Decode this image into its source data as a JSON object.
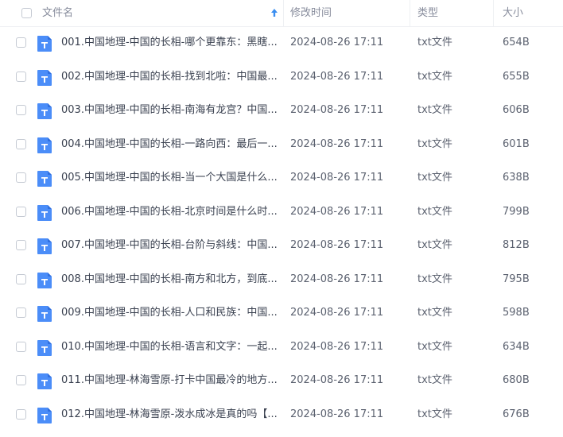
{
  "header": {
    "name": "文件名",
    "modified": "修改时间",
    "type": "类型",
    "size": "大小"
  },
  "colors": {
    "icon": "#4b8df8",
    "icon_fold": "#2f6fe0",
    "sort_arrow": "#3a8ef0"
  },
  "icons": {
    "file": "txt-file-icon",
    "sort": "sort-arrow-up-icon"
  },
  "files": [
    {
      "name": "001.中国地理-中国的长相-哪个更靠东：黑瞎...",
      "modified": "2024-08-26 17:11",
      "type": "txt文件",
      "size": "654B"
    },
    {
      "name": "002.中国地理-中国的长相-找到北啦：中国最...",
      "modified": "2024-08-26 17:11",
      "type": "txt文件",
      "size": "655B"
    },
    {
      "name": "003.中国地理-中国的长相-南海有龙宫？中国...",
      "modified": "2024-08-26 17:11",
      "type": "txt文件",
      "size": "606B"
    },
    {
      "name": "004.中国地理-中国的长相-一路向西：最后一...",
      "modified": "2024-08-26 17:11",
      "type": "txt文件",
      "size": "601B"
    },
    {
      "name": "005.中国地理-中国的长相-当一个大国是什么...",
      "modified": "2024-08-26 17:11",
      "type": "txt文件",
      "size": "638B"
    },
    {
      "name": "006.中国地理-中国的长相-北京时间是什么时...",
      "modified": "2024-08-26 17:11",
      "type": "txt文件",
      "size": "799B"
    },
    {
      "name": "007.中国地理-中国的长相-台阶与斜线：中国...",
      "modified": "2024-08-26 17:11",
      "type": "txt文件",
      "size": "812B"
    },
    {
      "name": "008.中国地理-中国的长相-南方和北方，到底...",
      "modified": "2024-08-26 17:11",
      "type": "txt文件",
      "size": "795B"
    },
    {
      "name": "009.中国地理-中国的长相-人口和民族：中国...",
      "modified": "2024-08-26 17:11",
      "type": "txt文件",
      "size": "598B"
    },
    {
      "name": "010.中国地理-中国的长相-语言和文字：一起...",
      "modified": "2024-08-26 17:11",
      "type": "txt文件",
      "size": "634B"
    },
    {
      "name": "011.中国地理-林海雪原-打卡中国最冷的地方...",
      "modified": "2024-08-26 17:11",
      "type": "txt文件",
      "size": "680B"
    },
    {
      "name": "012.中国地理-林海雪原-泼水成冰是真的吗【...",
      "modified": "2024-08-26 17:11",
      "type": "txt文件",
      "size": "676B"
    }
  ]
}
